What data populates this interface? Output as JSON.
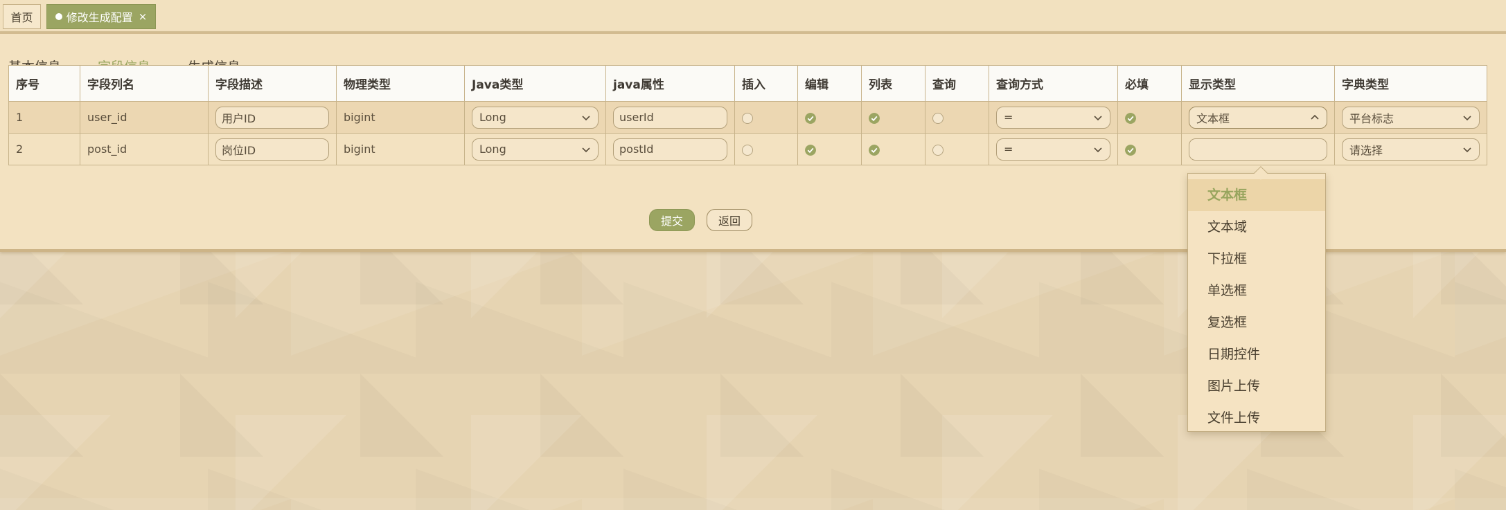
{
  "tabs": {
    "home": "首页",
    "active": "修改生成配置",
    "close": "×"
  },
  "subtabs": [
    "基本信息",
    "字段信息",
    "生成信息"
  ],
  "table": {
    "headers": [
      "序号",
      "字段列名",
      "字段描述",
      "物理类型",
      "Java类型",
      "java属性",
      "插入",
      "编辑",
      "列表",
      "查询",
      "查询方式",
      "必填",
      "显示类型",
      "字典类型"
    ],
    "rows": [
      {
        "index": "1",
        "column": "user_id",
        "desc": "用户ID",
        "physical": "bigint",
        "java_type": "Long",
        "java_field": "userId",
        "insert": false,
        "edit": true,
        "list": true,
        "query": false,
        "query_type": "=",
        "required": true,
        "display_type": "文本框",
        "dict_type": "平台标志"
      },
      {
        "index": "2",
        "column": "post_id",
        "desc": "岗位ID",
        "physical": "bigint",
        "java_type": "Long",
        "java_field": "postId",
        "insert": false,
        "edit": true,
        "list": true,
        "query": false,
        "query_type": "=",
        "required": true,
        "display_type": "",
        "dict_type": "请选择"
      }
    ]
  },
  "buttons": {
    "submit": "提交",
    "back": "返回"
  },
  "dropdown": {
    "selected": "文本框",
    "options": [
      "文本框",
      "文本域",
      "下拉框",
      "单选框",
      "复选框",
      "日期控件",
      "图片上传",
      "文件上传"
    ]
  },
  "colors": {
    "accent": "#9ba562",
    "card": "#f3e2c1",
    "background": "#e6d4b2"
  },
  "icons": {
    "check": "check-circle-icon",
    "chevron_down": "chevron-down-icon",
    "chevron_up": "chevron-up-icon",
    "close": "close-icon"
  }
}
